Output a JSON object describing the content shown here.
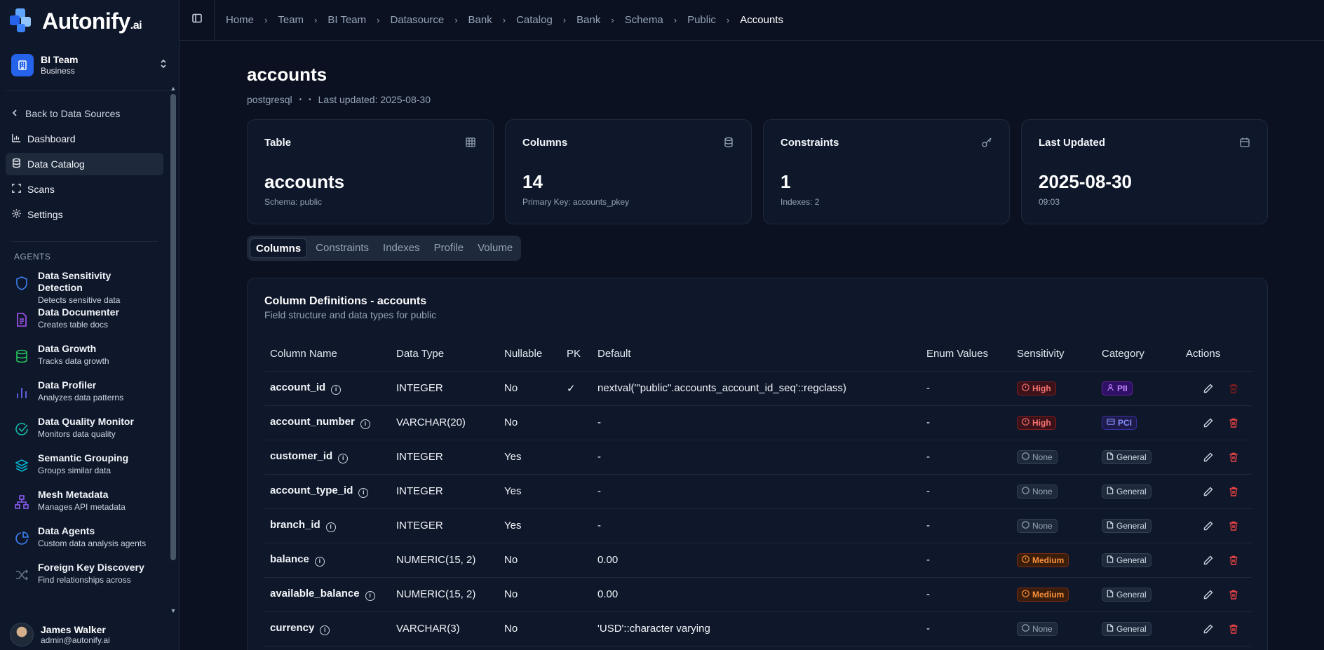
{
  "brand": {
    "name": "Autonify",
    "suffix": ".ai"
  },
  "team": {
    "name": "BI Team",
    "plan": "Business"
  },
  "sidebar": {
    "back_label": "Back to Data Sources",
    "nav": [
      {
        "label": "Dashboard",
        "icon": "chart-icon"
      },
      {
        "label": "Data Catalog",
        "icon": "database-icon"
      },
      {
        "label": "Scans",
        "icon": "scan-icon"
      },
      {
        "label": "Settings",
        "icon": "gear-icon"
      }
    ],
    "agents_heading": "AGENTS",
    "agents": [
      {
        "title": "Data Sensitivity Detection",
        "desc": "Detects sensitive data",
        "icon": "shield-icon",
        "color": "#3b82f6"
      },
      {
        "title": "Data Documenter",
        "desc": "Creates table docs",
        "icon": "document-icon",
        "color": "#a855f7"
      },
      {
        "title": "Data Growth",
        "desc": "Tracks data growth",
        "icon": "database-icon",
        "color": "#22c55e"
      },
      {
        "title": "Data Profiler",
        "desc": "Analyzes data patterns",
        "icon": "bar-chart-icon",
        "color": "#6366f1"
      },
      {
        "title": "Data Quality Monitor",
        "desc": "Monitors data quality",
        "icon": "check-circle-icon",
        "color": "#14b8a6"
      },
      {
        "title": "Semantic Grouping",
        "desc": "Groups similar data",
        "icon": "layers-icon",
        "color": "#06b6d4"
      },
      {
        "title": "Mesh Metadata",
        "desc": "Manages API metadata",
        "icon": "network-icon",
        "color": "#8b5cf6"
      },
      {
        "title": "Data Agents",
        "desc": "Custom data analysis agents",
        "icon": "pie-icon",
        "color": "#3b82f6"
      },
      {
        "title": "Foreign Key Discovery",
        "desc": "Find relationships across",
        "icon": "shuffle-icon",
        "color": "#64748b"
      }
    ]
  },
  "user": {
    "name": "James Walker",
    "email": "admin@autonify.ai"
  },
  "breadcrumbs": [
    "Home",
    "Team",
    "BI Team",
    "Datasource",
    "Bank",
    "Catalog",
    "Bank",
    "Schema",
    "Public",
    "Accounts"
  ],
  "page": {
    "title": "accounts",
    "engine": "postgresql",
    "last_updated": "Last updated: 2025-08-30"
  },
  "cards": [
    {
      "label": "Table",
      "value": "accounts",
      "sub": "Schema: public",
      "icon": "table-icon"
    },
    {
      "label": "Columns",
      "value": "14",
      "sub": "Primary Key: accounts_pkey",
      "icon": "database-icon"
    },
    {
      "label": "Constraints",
      "value": "1",
      "sub": "Indexes: 2",
      "icon": "key-icon"
    },
    {
      "label": "Last Updated",
      "value": "2025-08-30",
      "sub": "09:03",
      "icon": "calendar-icon"
    }
  ],
  "tabs": [
    "Columns",
    "Constraints",
    "Indexes",
    "Profile",
    "Volume"
  ],
  "table": {
    "title": "Column Definitions - accounts",
    "subtitle": "Field structure and data types for public",
    "headers": [
      "Column Name",
      "Data Type",
      "Nullable",
      "PK",
      "Default",
      "Enum Values",
      "Sensitivity",
      "Category",
      "Actions"
    ],
    "rows": [
      {
        "name": "account_id",
        "type": "INTEGER",
        "nullable": "No",
        "pk": "✓",
        "default": "nextval('\"public\".accounts_account_id_seq'::regclass)",
        "enum": "-",
        "sensitivity": "High",
        "category": "PII"
      },
      {
        "name": "account_number",
        "type": "VARCHAR(20)",
        "nullable": "No",
        "pk": "",
        "default": "-",
        "enum": "-",
        "sensitivity": "High",
        "category": "PCI"
      },
      {
        "name": "customer_id",
        "type": "INTEGER",
        "nullable": "Yes",
        "pk": "",
        "default": "-",
        "enum": "-",
        "sensitivity": "None",
        "category": "General"
      },
      {
        "name": "account_type_id",
        "type": "INTEGER",
        "nullable": "Yes",
        "pk": "",
        "default": "-",
        "enum": "-",
        "sensitivity": "None",
        "category": "General"
      },
      {
        "name": "branch_id",
        "type": "INTEGER",
        "nullable": "Yes",
        "pk": "",
        "default": "-",
        "enum": "-",
        "sensitivity": "None",
        "category": "General"
      },
      {
        "name": "balance",
        "type": "NUMERIC(15, 2)",
        "nullable": "No",
        "pk": "",
        "default": "0.00",
        "enum": "-",
        "sensitivity": "Medium",
        "category": "General"
      },
      {
        "name": "available_balance",
        "type": "NUMERIC(15, 2)",
        "nullable": "No",
        "pk": "",
        "default": "0.00",
        "enum": "-",
        "sensitivity": "Medium",
        "category": "General"
      },
      {
        "name": "currency",
        "type": "VARCHAR(3)",
        "nullable": "No",
        "pk": "",
        "default": "'USD'::character varying",
        "enum": "-",
        "sensitivity": "None",
        "category": "General"
      }
    ]
  }
}
